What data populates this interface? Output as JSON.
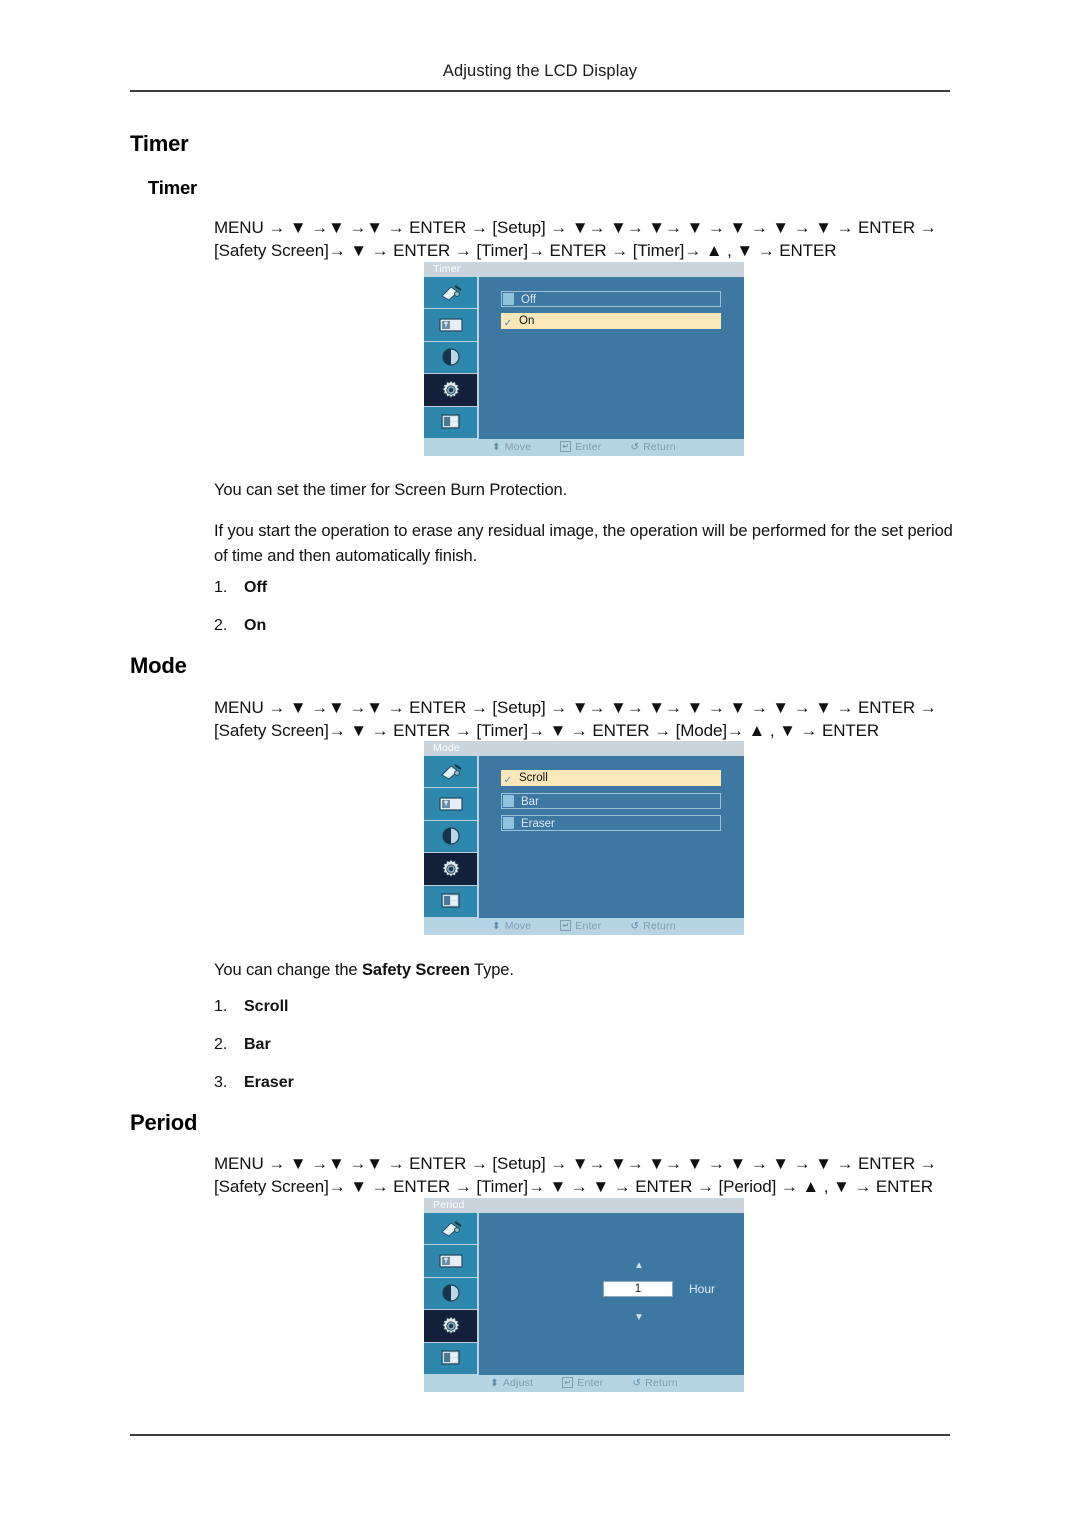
{
  "page": {
    "running_header": "Adjusting the LCD Display"
  },
  "sections": [
    {
      "heading": "Timer",
      "subheading": "Timer",
      "nav_path_line1": "MENU → ▼ →▼ →▼ → ENTER → [Setup] → ▼→ ▼→ ▼→ ▼ → ▼ → ▼ → ▼ → ENTER →",
      "nav_path_line2": "[Safety Screen]→ ▼ → ENTER → [Timer]→ ENTER → [Timer]→ ▲ , ▼ → ENTER",
      "paragraph1": "You can set the timer for Screen Burn Protection.",
      "paragraph2": "If you start the operation to erase any residual image, the operation will be performed for the set period of time and then automatically finish.",
      "options": [
        {
          "num": "1.",
          "label": "Off"
        },
        {
          "num": "2.",
          "label": "On"
        }
      ]
    },
    {
      "heading": "Mode",
      "nav_path_line1": "MENU → ▼ →▼ →▼ → ENTER → [Setup] → ▼→ ▼→ ▼→ ▼ → ▼ → ▼ → ▼ → ENTER →",
      "nav_path_line2": "[Safety Screen]→ ▼ → ENTER → [Timer]→ ▼ → ENTER → [Mode]→ ▲ , ▼ → ENTER",
      "paragraph1_pre": "You can change the ",
      "paragraph1_bold": "Safety Screen",
      "paragraph1_post": " Type.",
      "options": [
        {
          "num": "1.",
          "label": "Scroll"
        },
        {
          "num": "2.",
          "label": "Bar"
        },
        {
          "num": "3.",
          "label": "Eraser"
        }
      ]
    },
    {
      "heading": "Period",
      "nav_path_line1": "MENU → ▼ →▼ →▼ → ENTER → [Setup] → ▼→ ▼→ ▼→ ▼ → ▼ → ▼ → ▼ → ENTER →",
      "nav_path_line2": "[Safety Screen]→ ▼ → ENTER → [Timer]→ ▼ → ▼ → ENTER → [Period] → ▲ , ▼ → ENTER"
    }
  ],
  "osd_timer": {
    "title": "Timer",
    "sidebar_icons": [
      "input-source-icon",
      "picture-icon",
      "sound-icon",
      "setup-gear-icon",
      "multi-control-icon"
    ],
    "selected_sidebar_index": 3,
    "rows": [
      {
        "label": "Off",
        "selected": false
      },
      {
        "label": "On",
        "selected": true
      }
    ],
    "footer": [
      {
        "glyph": "⬍",
        "label": "Move"
      },
      {
        "glyph": "↵",
        "label": "Enter"
      },
      {
        "glyph": "↺",
        "label": "Return"
      }
    ]
  },
  "osd_mode": {
    "title": "Mode",
    "sidebar_icons": [
      "input-source-icon",
      "picture-icon",
      "sound-icon",
      "setup-gear-icon",
      "multi-control-icon"
    ],
    "selected_sidebar_index": 3,
    "rows": [
      {
        "label": "Scroll",
        "selected": true
      },
      {
        "label": "Bar",
        "selected": false
      },
      {
        "label": "Eraser",
        "selected": false
      }
    ],
    "footer": [
      {
        "glyph": "⬍",
        "label": "Move"
      },
      {
        "glyph": "↵",
        "label": "Enter"
      },
      {
        "glyph": "↺",
        "label": "Return"
      }
    ]
  },
  "osd_period": {
    "title": "Period",
    "sidebar_icons": [
      "input-source-icon",
      "picture-icon",
      "sound-icon",
      "setup-gear-icon",
      "multi-control-icon"
    ],
    "selected_sidebar_index": 3,
    "spinner": {
      "value": "1",
      "unit": "Hour",
      "up_arrow": "▲",
      "down_arrow": "▼"
    },
    "footer": [
      {
        "glyph": "⬍",
        "label": "Adjust"
      },
      {
        "glyph": "↵",
        "label": "Enter"
      },
      {
        "glyph": "↺",
        "label": "Return"
      }
    ]
  },
  "colors": {
    "osd_background": "#3d78a3",
    "osd_title_bar": "#c9d4dc",
    "osd_sidebar_item": "#2e88ae",
    "osd_sidebar_selected": "#12203a",
    "osd_row_selected": "#fae7b9",
    "osd_footer": "#b6d4e4",
    "rule": "#3d3d3d"
  }
}
